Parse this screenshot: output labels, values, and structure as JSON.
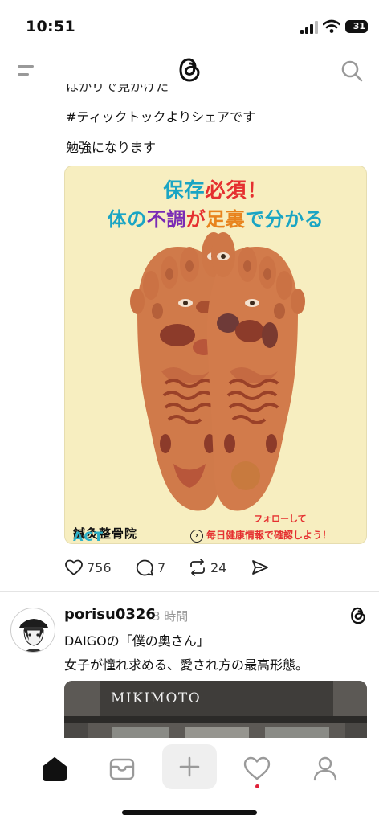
{
  "status_bar": {
    "time": "10:51",
    "battery": "31"
  },
  "post1": {
    "cut_off_line": "はかりで見かけた",
    "hashtag_line": "#ティックトックよりシェアです",
    "comment_line": "勉強になります",
    "image": {
      "title1_a": "保存",
      "title1_b": "必須！",
      "title2_a": "体の",
      "title2_b": "不調",
      "title2_c": "が",
      "title2_d": "足裏",
      "title2_e": "で分かる",
      "clinic_a": "鍼灸整骨院",
      "clinic_b": "ACT",
      "follow": "フォローして",
      "daily": "毎日健康情報で確認しよう！",
      "arrow": "›"
    },
    "likes": "756",
    "replies": "7",
    "reposts": "24"
  },
  "post2": {
    "username": "porisu0326",
    "time": "3 時間",
    "line1": "DAIGOの「僕の奥さん」",
    "line2": "女子が憧れ求める、愛され方の最高形態。",
    "image_sign": "MIKIMOTO"
  },
  "colors": {
    "accent_cyan": "#1aa5c4",
    "accent_red": "#e53030",
    "notification": "#e0223a"
  }
}
